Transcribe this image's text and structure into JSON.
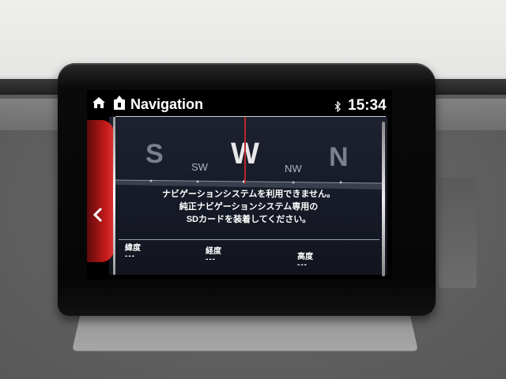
{
  "header": {
    "title": "Navigation",
    "time": "15:34"
  },
  "compass": {
    "directions": [
      "S",
      "SW",
      "W",
      "NW",
      "N"
    ],
    "active": "W"
  },
  "message": {
    "lines": [
      "ナビゲーションシステムを利用できません。",
      "純正ナビゲーションシステム専用の",
      "SDカードを装着してください。"
    ]
  },
  "info": {
    "latitude_label": "緯度",
    "latitude_value": "---",
    "longitude_label": "経度",
    "longitude_value": "---",
    "altitude_label": "高度",
    "altitude_value": "---"
  },
  "colors": {
    "accent_red": "#c41a1a",
    "heading_line": "#b8282a"
  }
}
